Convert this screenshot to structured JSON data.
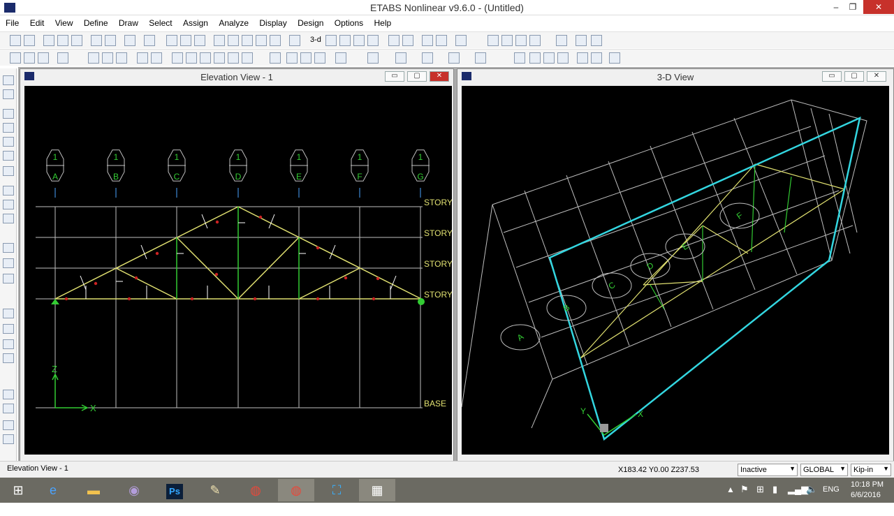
{
  "app": {
    "title": "ETABS Nonlinear v9.6.0 - (Untitled)",
    "min": "–",
    "max": "❐",
    "close": "✕"
  },
  "menu": [
    "File",
    "Edit",
    "View",
    "Define",
    "Draw",
    "Select",
    "Assign",
    "Analyze",
    "Display",
    "Design",
    "Options",
    "Help"
  ],
  "toolbar": {
    "view3d": "3-d"
  },
  "windows": {
    "elevation": {
      "title": "Elevation View - 1",
      "grid_bubble_top": "1",
      "grid_labels": [
        "A",
        "B",
        "C",
        "D",
        "E",
        "F",
        "G"
      ],
      "story_labels": [
        "STORY",
        "STORY",
        "STORY",
        "STORY"
      ],
      "base_label": "BASE",
      "axis_z": "Z",
      "axis_x": "X"
    },
    "view3d": {
      "title": "3-D View",
      "grid_labels": [
        "A",
        "B",
        "C",
        "D",
        "E",
        "F"
      ],
      "axis_x": "X",
      "axis_y": "Y"
    },
    "min": "▭",
    "max": "▢",
    "close": "✕"
  },
  "status": {
    "active_view": "Elevation View - 1",
    "coords": "X183.42  Y0.00  Z237.53",
    "mode": "Inactive",
    "coord_system": "GLOBAL",
    "units": "Kip-in"
  },
  "taskbar": {
    "apps": [
      "start-icon",
      "internet-explorer-icon",
      "file-explorer-icon",
      "viber-icon",
      "photoshop-icon",
      "paint-icon",
      "chrome-icon",
      "chrome-icon",
      "capture-icon",
      "etabs-icon"
    ],
    "photoshop_label": "Ps",
    "language": "ENG",
    "time": "10:18 PM",
    "date": "6/6/2016"
  },
  "colors": {
    "grid_line": "#bfbfbf",
    "truss": "#e0e070",
    "vertical_member": "#33cc33",
    "label_green": "#33cc33",
    "story_label": "#e0e070",
    "highlight_cyan": "#33d6e0",
    "load_node": "#cc2222"
  }
}
